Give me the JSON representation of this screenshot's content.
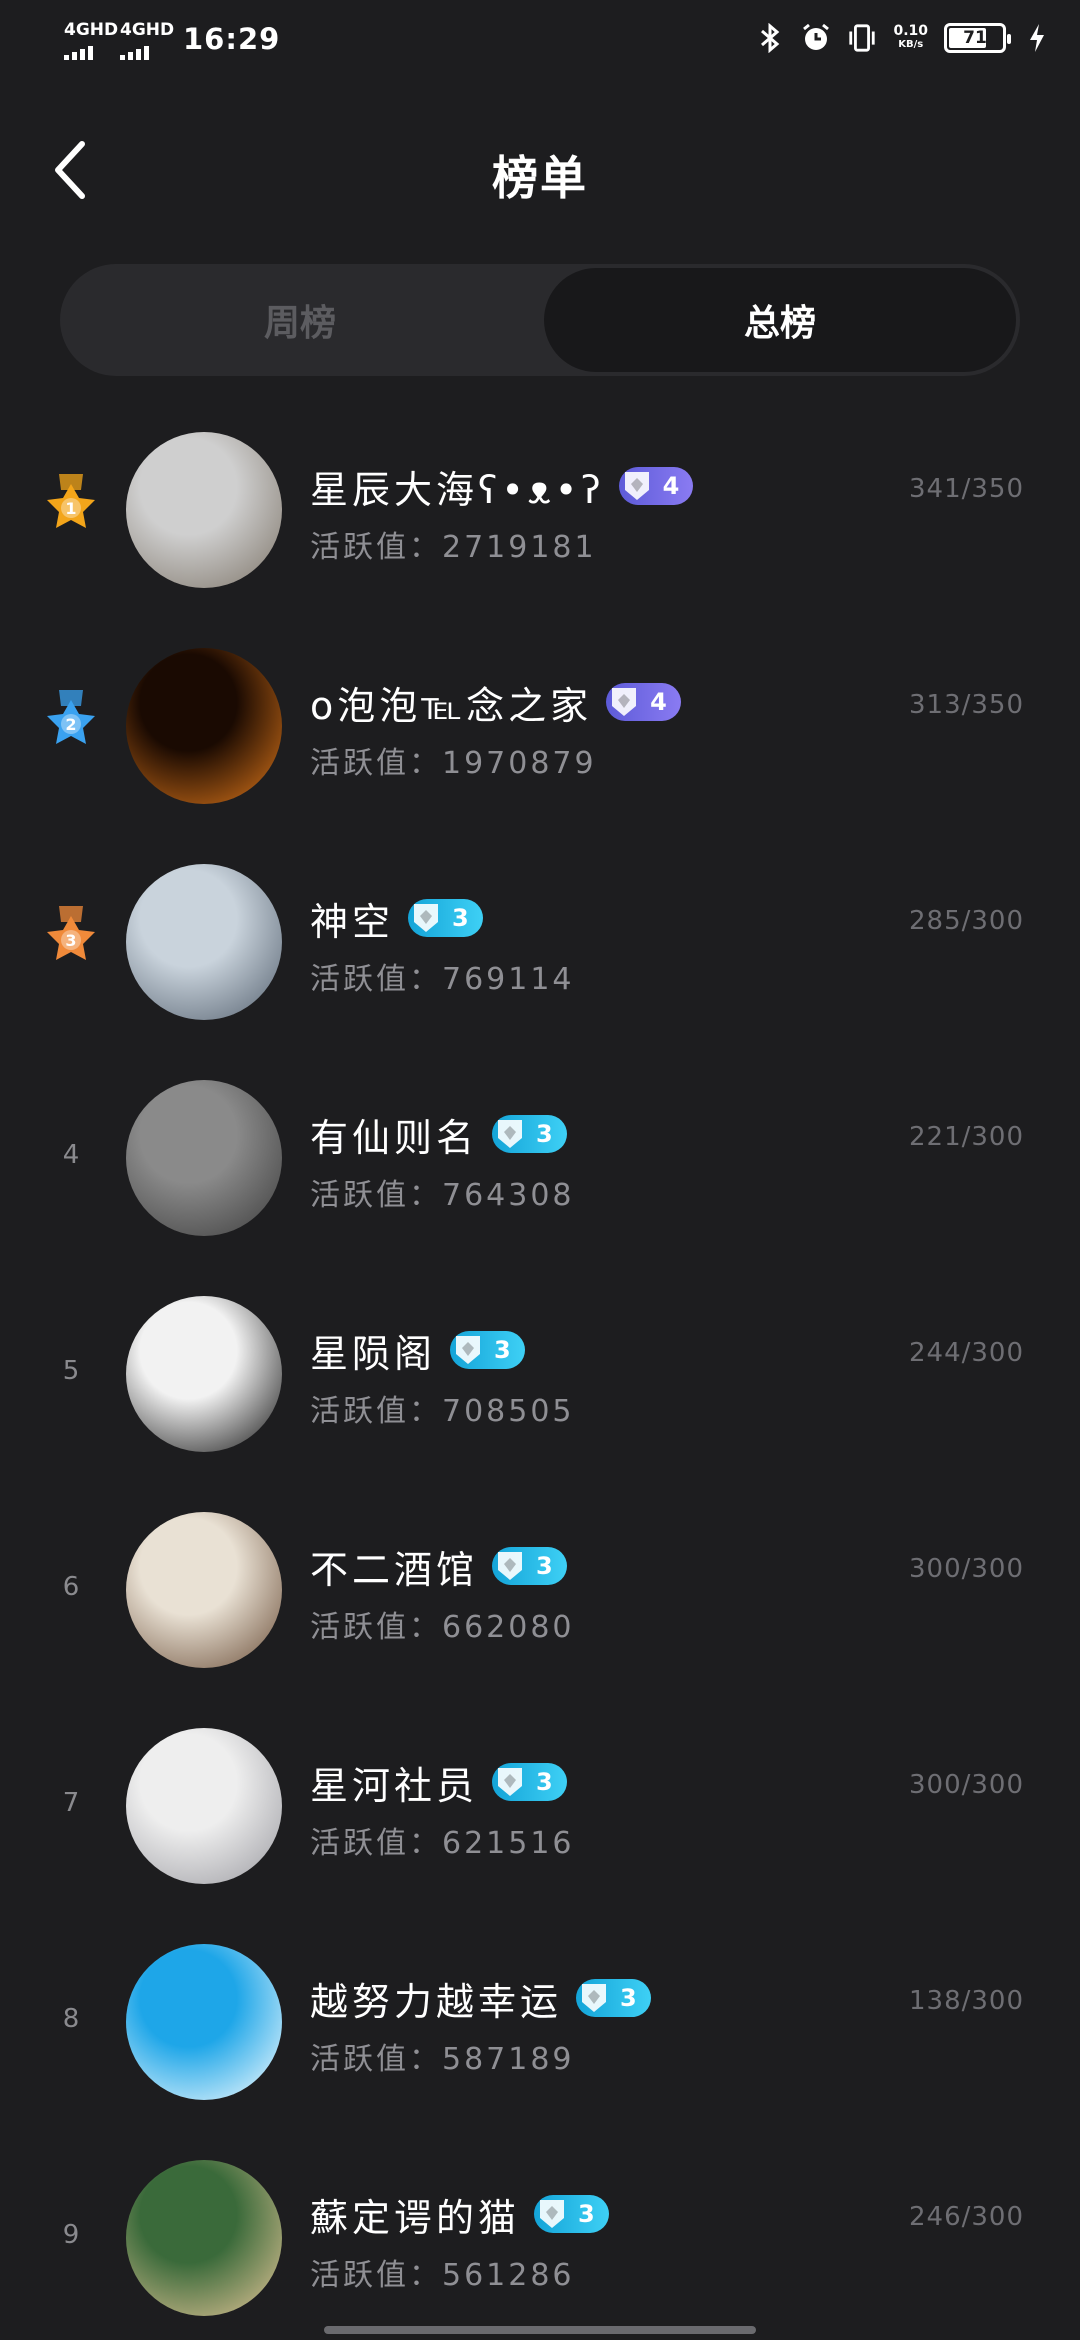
{
  "status_bar": {
    "signal_1": "4GHD",
    "signal_2": "4GHD",
    "time": "16:29",
    "net_speed_value": "0.10",
    "net_speed_unit": "KB/s",
    "battery_level": "71",
    "battery_fraction": 0.71,
    "icons": [
      "bluetooth-icon",
      "alarm-icon",
      "vibrate-icon",
      "charging-icon"
    ]
  },
  "header": {
    "title": "榜单",
    "back_icon": "chevron-left-icon"
  },
  "tabs": [
    {
      "label": "周榜",
      "active": false
    },
    {
      "label": "总榜",
      "active": true
    }
  ],
  "stat_label": "活跃值：",
  "ranking": [
    {
      "rank": "1",
      "medal": "gold",
      "name": "星辰大海ʕ•ᴥ•ʔ",
      "level": "4",
      "level_style": "lv4",
      "score": "2719181",
      "progress": "341/350",
      "avatar_colors": [
        "#cfcfcf",
        "#7d7468"
      ]
    },
    {
      "rank": "2",
      "medal": "silver",
      "name": "o泡泡℡念之家",
      "level": "4",
      "level_style": "lv4",
      "score": "1970879",
      "progress": "313/350",
      "avatar_colors": [
        "#1a0a02",
        "#e0781a"
      ]
    },
    {
      "rank": "3",
      "medal": "bronze",
      "name": "神空",
      "level": "3",
      "level_style": "lv3",
      "score": "769114",
      "progress": "285/300",
      "avatar_colors": [
        "#c9d3dc",
        "#54606e"
      ]
    },
    {
      "rank": "4",
      "medal": "",
      "name": "有仙则名",
      "level": "3",
      "level_style": "lv3",
      "score": "764308",
      "progress": "221/300",
      "avatar_colors": [
        "#8a8a8a",
        "#3c3c3c"
      ]
    },
    {
      "rank": "5",
      "medal": "",
      "name": "星陨阁",
      "level": "3",
      "level_style": "lv3",
      "score": "708505",
      "progress": "244/300",
      "avatar_colors": [
        "#f2f2f2",
        "#111111"
      ]
    },
    {
      "rank": "6",
      "medal": "",
      "name": "不二酒馆",
      "level": "3",
      "level_style": "lv3",
      "score": "662080",
      "progress": "300/300",
      "avatar_colors": [
        "#e9e1d4",
        "#6a4d37"
      ]
    },
    {
      "rank": "7",
      "medal": "",
      "name": "星河社员",
      "level": "3",
      "level_style": "lv3",
      "score": "621516",
      "progress": "300/300",
      "avatar_colors": [
        "#eeeeee",
        "#9a9aa0"
      ]
    },
    {
      "rank": "8",
      "medal": "",
      "name": "越努力越幸运",
      "level": "3",
      "level_style": "lv3",
      "score": "587189",
      "progress": "138/300",
      "avatar_colors": [
        "#1ea6e8",
        "#ffffff"
      ]
    },
    {
      "rank": "9",
      "medal": "",
      "name": "蘇定谔的猫",
      "level": "3",
      "level_style": "lv3",
      "score": "561286",
      "progress": "246/300",
      "avatar_colors": [
        "#3a6a3a",
        "#e8c79a"
      ]
    }
  ],
  "colors": {
    "background": "#1d1d1f",
    "medal_gold": "#f3a51a",
    "medal_silver": "#3aa2f0",
    "medal_bronze": "#f08a3a",
    "level4": "#6f66e2",
    "level3": "#22b6e6"
  }
}
